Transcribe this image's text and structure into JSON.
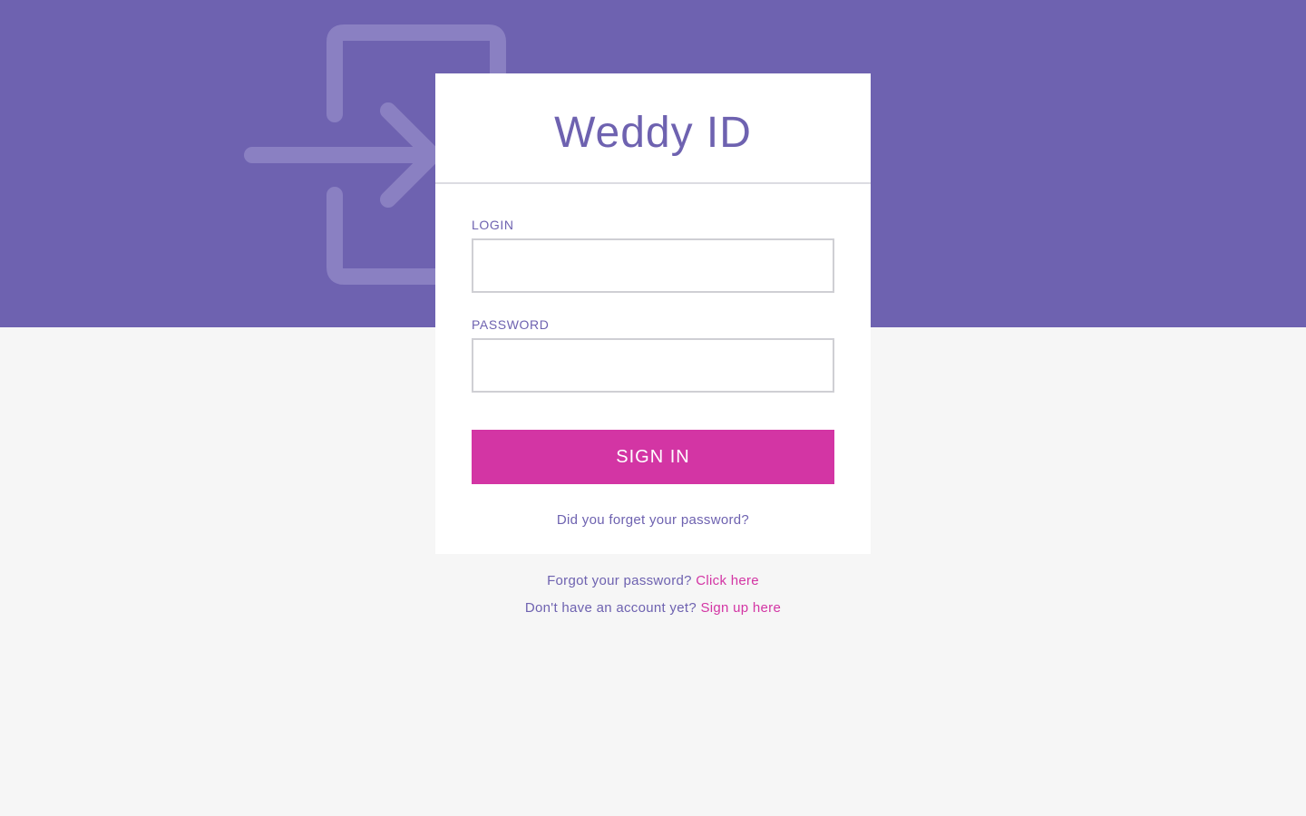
{
  "colors": {
    "hero_background": "#6e62b0",
    "accent_purple": "#6e62b0",
    "button_pink": "#d335a4",
    "page_background": "#f6f6f6"
  },
  "hero": {
    "icon": "sign-in-icon"
  },
  "card": {
    "title": "Weddy ID",
    "login_label": "LOGIN",
    "login_value": "",
    "password_label": "PASSWORD",
    "password_value": "",
    "signin_label": "SIGN IN",
    "forgot_link": "Did you forget your password?"
  },
  "footer": {
    "forgot_text": "Forgot your password?",
    "forgot_link": "Click here",
    "signup_text": "Don't have an account yet?",
    "signup_link": "Sign up here"
  }
}
